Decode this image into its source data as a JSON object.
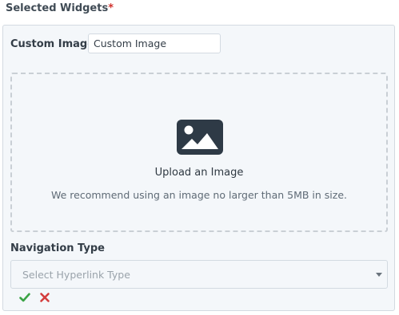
{
  "section": {
    "title": "Selected Widgets",
    "required_mark": "*"
  },
  "custom_image": {
    "label": "Custom Image",
    "required_mark": "*",
    "value": "Custom Image"
  },
  "upload": {
    "icon": "image-icon",
    "title": "Upload an Image",
    "hint": "We recommend using an image no larger than 5MB in size."
  },
  "navigation": {
    "label": "Navigation Type",
    "placeholder": "Select Hyperlink Type"
  },
  "actions": {
    "confirm_icon": "check-icon",
    "cancel_icon": "close-icon"
  },
  "colors": {
    "required": "#d0312d",
    "confirm": "#3aa345",
    "cancel": "#d43d3d",
    "panel_bg": "#f4f7fa",
    "icon_dark": "#2e3a46"
  }
}
